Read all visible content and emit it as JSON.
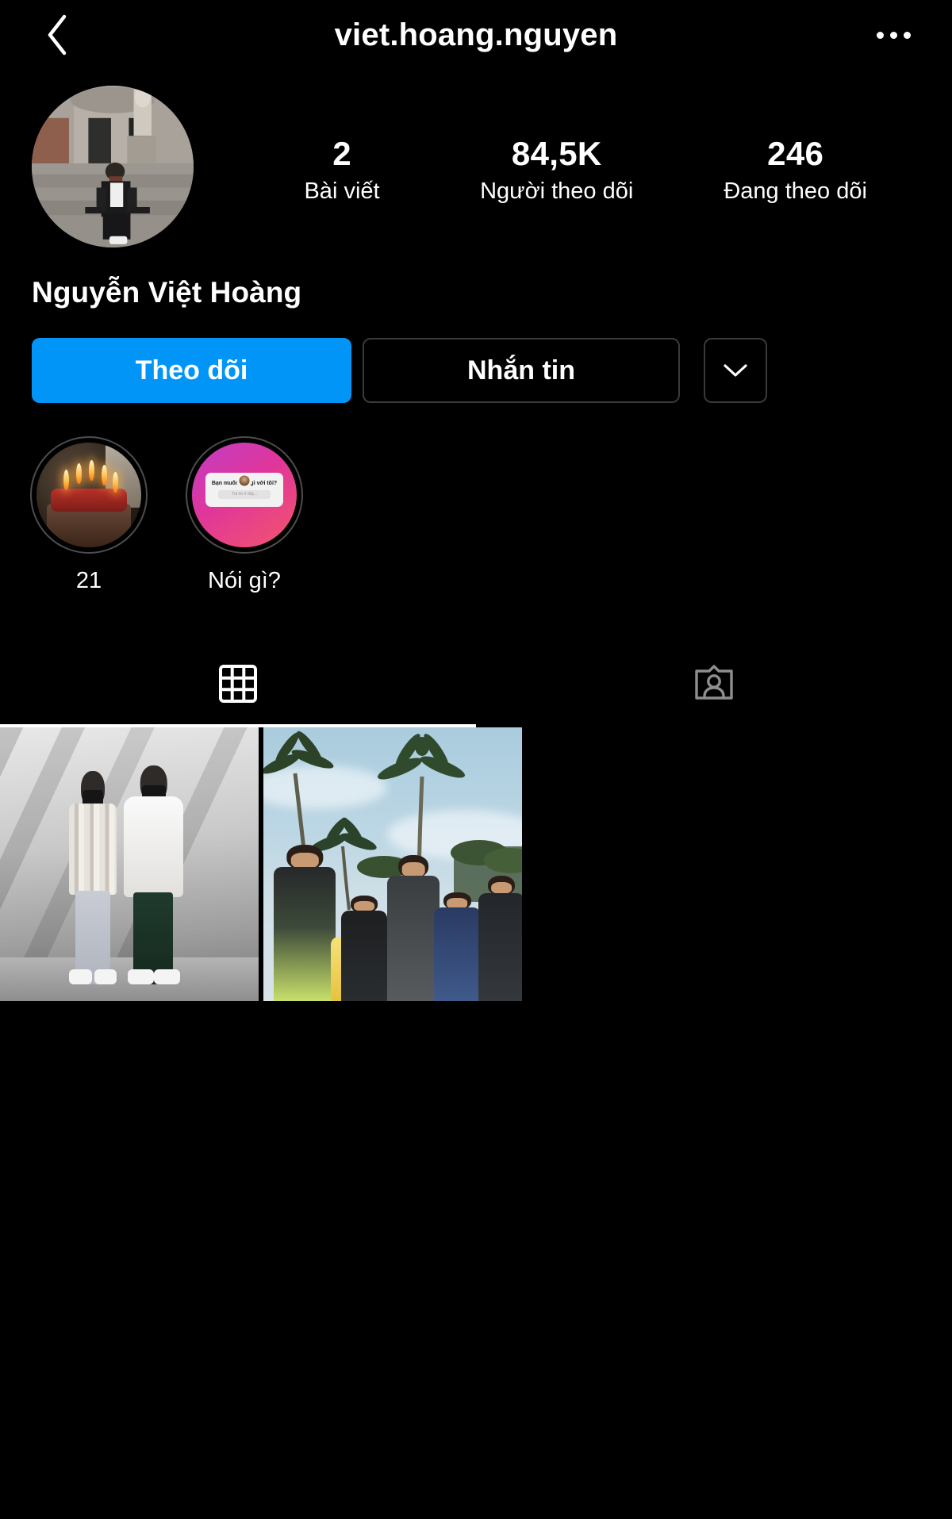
{
  "header": {
    "title": "viet.hoang.nguyen",
    "back_icon": "chevron-left-icon",
    "more_icon": "more-options-icon"
  },
  "profile": {
    "avatar_alt": "profile-photo",
    "display_name": "Nguyễn Việt Hoàng",
    "stats": [
      {
        "value": "2",
        "label": "Bài viết"
      },
      {
        "value": "84,5K",
        "label": "Người theo dõi"
      },
      {
        "value": "246",
        "label": "Đang theo dõi"
      }
    ],
    "actions": {
      "follow_label": "Theo dõi",
      "message_label": "Nhắn tin",
      "more_icon": "chevron-down-icon"
    },
    "accent_color": "#0095f6",
    "border_color": "#3a3a3a",
    "background_color": "#000000"
  },
  "highlights": [
    {
      "label": "21",
      "art": "birthday-cake"
    },
    {
      "label": "Nói gì?",
      "art": "question-sticker",
      "sticker_text": "Bạn muốn nói gì với tôi?",
      "sticker_placeholder": "Trả lời ở đây..."
    }
  ],
  "tabs": [
    {
      "name": "grid",
      "icon": "grid-icon",
      "active": true
    },
    {
      "name": "tagged",
      "icon": "tagged-person-icon",
      "active": false
    }
  ],
  "posts": [
    {
      "alt": "two-people-in-masks-grayscale"
    },
    {
      "alt": "group-at-beach-with-palm-trees"
    }
  ]
}
